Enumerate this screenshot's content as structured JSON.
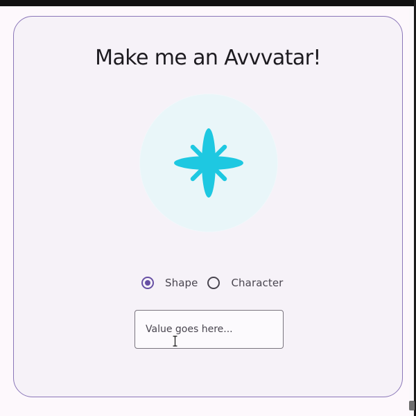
{
  "card": {
    "title": "Make me an Avvvatar!"
  },
  "avatar": {
    "icon": "four-petal-flower-icon",
    "icon_color": "#1ec8e1",
    "background_color": "#e9f6f9"
  },
  "mode": {
    "options": [
      {
        "label": "Shape",
        "selected": true
      },
      {
        "label": "Character",
        "selected": false
      }
    ]
  },
  "value_input": {
    "placeholder": "Value goes here...",
    "value": ""
  },
  "theme": {
    "accent": "#6750a4",
    "card_border": "#8a76b8",
    "card_background": "#f6f2f8"
  }
}
